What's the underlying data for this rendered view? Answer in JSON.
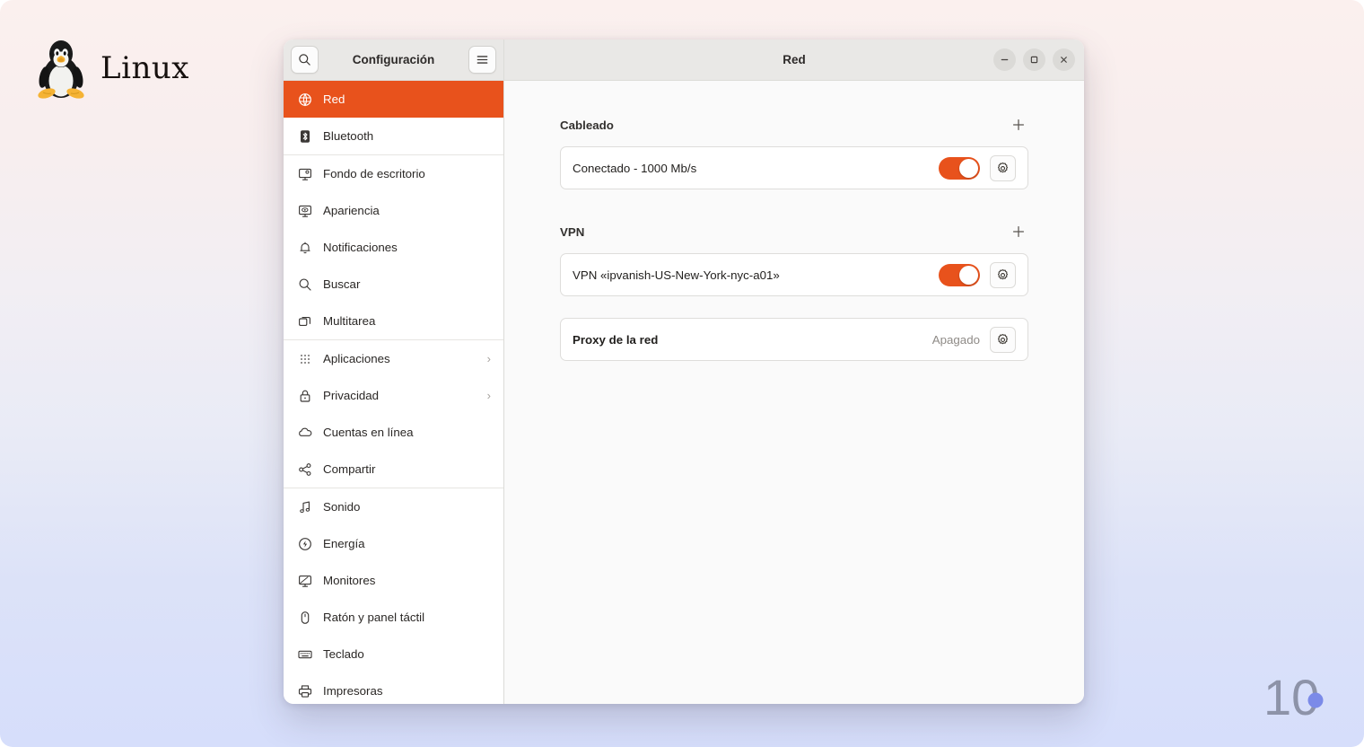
{
  "branding": {
    "logo_text": "Linux",
    "logo_icon": "tux-penguin-icon",
    "watermark": "10"
  },
  "window": {
    "sidebar_title": "Configuración",
    "content_title": "Red",
    "search_icon": "search-icon",
    "menu_icon": "hamburger-menu-icon",
    "controls": {
      "minimize": "minimize-icon",
      "maximize": "maximize-icon",
      "close": "close-icon"
    }
  },
  "sidebar": {
    "groups": [
      {
        "items": [
          {
            "label": "Red",
            "icon": "network-globe-icon",
            "selected": true,
            "chevron": ""
          },
          {
            "label": "Bluetooth",
            "icon": "bluetooth-icon",
            "selected": false,
            "chevron": ""
          }
        ]
      },
      {
        "items": [
          {
            "label": "Fondo de escritorio",
            "icon": "wallpaper-icon",
            "selected": false,
            "chevron": ""
          },
          {
            "label": "Apariencia",
            "icon": "appearance-icon",
            "selected": false,
            "chevron": ""
          },
          {
            "label": "Notificaciones",
            "icon": "bell-icon",
            "selected": false,
            "chevron": ""
          },
          {
            "label": "Buscar",
            "icon": "search-icon",
            "selected": false,
            "chevron": ""
          },
          {
            "label": "Multitarea",
            "icon": "multitasking-windows-icon",
            "selected": false,
            "chevron": ""
          }
        ]
      },
      {
        "items": [
          {
            "label": "Aplicaciones",
            "icon": "apps-grid-icon",
            "selected": false,
            "chevron": "›"
          },
          {
            "label": "Privacidad",
            "icon": "lock-icon",
            "selected": false,
            "chevron": "›"
          },
          {
            "label": "Cuentas en línea",
            "icon": "cloud-icon",
            "selected": false,
            "chevron": ""
          },
          {
            "label": "Compartir",
            "icon": "share-nodes-icon",
            "selected": false,
            "chevron": ""
          }
        ]
      },
      {
        "items": [
          {
            "label": "Sonido",
            "icon": "music-note-icon",
            "selected": false,
            "chevron": ""
          },
          {
            "label": "Energía",
            "icon": "power-bolt-icon",
            "selected": false,
            "chevron": ""
          },
          {
            "label": "Monitores",
            "icon": "display-monitor-icon",
            "selected": false,
            "chevron": ""
          },
          {
            "label": "Ratón y panel táctil",
            "icon": "mouse-icon",
            "selected": false,
            "chevron": ""
          },
          {
            "label": "Teclado",
            "icon": "keyboard-icon",
            "selected": false,
            "chevron": ""
          },
          {
            "label": "Impresoras",
            "icon": "printer-icon",
            "selected": false,
            "chevron": ""
          }
        ]
      }
    ]
  },
  "main": {
    "sections": [
      {
        "title": "Cableado",
        "add_icon": "plus-icon",
        "row": {
          "label": "Conectado - 1000 Mb/s",
          "bold": false,
          "toggle_on": true,
          "status": "",
          "gear_icon": "gear-icon"
        }
      },
      {
        "title": "VPN",
        "add_icon": "plus-icon",
        "row": {
          "label": "VPN «ipvanish-US-New-York-nyc-a01»",
          "bold": false,
          "toggle_on": true,
          "status": "",
          "gear_icon": "gear-icon"
        }
      }
    ],
    "proxy": {
      "label": "Proxy de la red",
      "status": "Apagado",
      "gear_icon": "gear-icon"
    }
  },
  "colors": {
    "accent": "#e8521c",
    "sidebar_bg": "#ffffff",
    "header_bg": "#e9e8e6",
    "content_bg": "#fafafa",
    "card_bg": "#ffffff"
  }
}
